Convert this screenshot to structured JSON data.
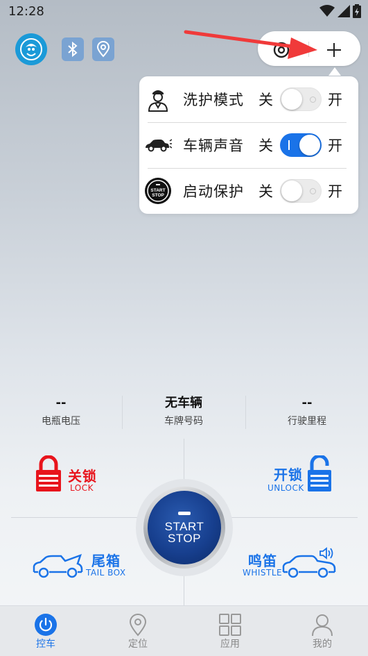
{
  "status_bar": {
    "time": "12:28"
  },
  "popup_menu": {
    "items": [
      {
        "label": "洗护模式",
        "off_label": "关",
        "on_label": "开",
        "enabled": false,
        "icon": "washer-person-icon"
      },
      {
        "label": "车辆声音",
        "off_label": "关",
        "on_label": "开",
        "enabled": true,
        "icon": "car-sound-icon"
      },
      {
        "label": "启动保护",
        "off_label": "关",
        "on_label": "开",
        "enabled": false,
        "icon": "start-stop-icon"
      }
    ],
    "start_icon_text": [
      "START",
      "STOP"
    ]
  },
  "info": {
    "battery": {
      "value": "--",
      "label": "电瓶电压"
    },
    "plate": {
      "value": "无车辆",
      "label": "车牌号码"
    },
    "mileage": {
      "value": "--",
      "label": "行驶里程"
    }
  },
  "controls": {
    "lock": {
      "cn": "关锁",
      "en": "LOCK",
      "color": "#e8141c"
    },
    "unlock": {
      "cn": "开锁",
      "en": "UNLOCK",
      "color": "#1a73e8"
    },
    "trunk": {
      "cn": "尾箱",
      "en": "TAIL BOX",
      "color": "#1a73e8"
    },
    "whistle": {
      "cn": "鸣笛",
      "en": "WHISTLE",
      "color": "#1a73e8"
    },
    "start_button": {
      "line1": "START",
      "line2": "STOP"
    }
  },
  "tabs": [
    {
      "label": "控车",
      "icon": "power-icon",
      "active": true
    },
    {
      "label": "定位",
      "icon": "location-pin-icon",
      "active": false
    },
    {
      "label": "应用",
      "icon": "grid-apps-icon",
      "active": false
    },
    {
      "label": "我的",
      "icon": "person-icon",
      "active": false
    }
  ],
  "colors": {
    "accent": "#1a73e8",
    "danger": "#e8141c",
    "avatar_bg": "#1b9ad8",
    "arrow": "#f03a3a"
  }
}
